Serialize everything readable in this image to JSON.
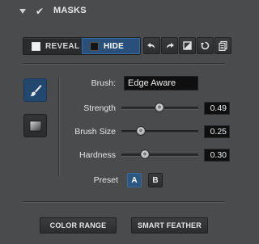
{
  "header": {
    "title": "MASKS",
    "expanded": true,
    "checked": true
  },
  "mode": {
    "reveal_label": "REVEAL",
    "hide_label": "HIDE",
    "selected": "HIDE"
  },
  "toolbar": {
    "icons": [
      "undo-arrow-icon",
      "redo-arrow-icon",
      "invert-mask-icon",
      "reset-icon",
      "copy-icon"
    ]
  },
  "tools": [
    {
      "name": "brush-icon",
      "selected": true
    },
    {
      "name": "gradient-icon",
      "selected": false
    }
  ],
  "brush": {
    "label": "Brush:",
    "value": "Edge Aware"
  },
  "sliders": [
    {
      "key": "strength",
      "label": "Strength",
      "value": "0.49",
      "fraction": 0.49
    },
    {
      "key": "brush_size",
      "label": "Brush Size",
      "value": "0.25",
      "fraction": 0.25
    },
    {
      "key": "hardness",
      "label": "Hardness",
      "value": "0.30",
      "fraction": 0.3
    }
  ],
  "preset": {
    "label": "Preset",
    "options": [
      "A",
      "B"
    ],
    "selected": "A"
  },
  "buttons": {
    "color_range": "COLOR RANGE",
    "smart_feather": "SMART FEATHER"
  },
  "colors": {
    "accent": "#28507a",
    "panel_bg": "#4a4b4d",
    "field_bg": "#0f0f10"
  }
}
